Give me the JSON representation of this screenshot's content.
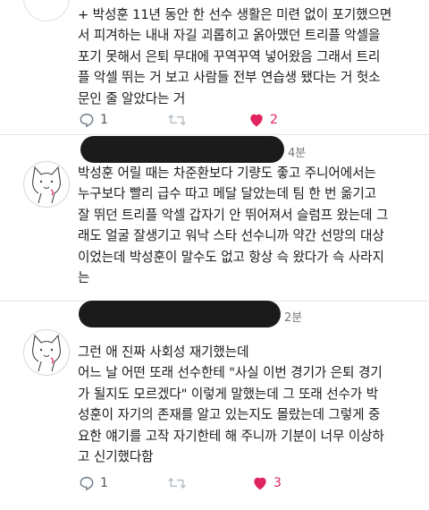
{
  "tweet1": {
    "text": "+ 박성훈 11년 동안 한 선수 생활은 미련 없이 포기했으면\n서 피겨하는 내내 자길 괴롭히고 옭아맸던 트리플 악셀을\n포기 못해서 은퇴 무대에 꾸역꾸역 넣어왔음 그래서 트리\n플 악셀 뛰는 거 보고 사람들 전부 연습생 됐다는 거 헛소\n문인 줄 알았다는 거",
    "replies": "1",
    "retweets": "",
    "likes": "2"
  },
  "tweet2": {
    "time": "4분",
    "text": "박성훈 어릴 때는 차준환보다 기량도 좋고 주니어에서는\n누구보다 빨리 급수 따고 메달 달았는데 팀 한 번 옮기고\n잘 뛰던 트리플 악셀 갑자기 안 뛰어져서 슬럼프 왔는데 그\n래도 얼굴 잘생기고 워낙 스타 선수니까 약간 선망의 대상\n이었는데 박성훈이 말수도 없고 항상 슥 왔다가 슥 사라지\n는",
    "replies": "",
    "retweets": "",
    "likes": ""
  },
  "tweet3": {
    "time": "2분",
    "text": "그런 애 진짜 사회성 재기했는데\n어느 날 어떤 또래 선수한테 \"사실 이번 경기가 은퇴 경기\n가 될지도 모르겠다\" 이렇게 말했는데 그 또래 선수가 박\n성훈이 자기의 존재를 알고 있는지도 몰랐는데 그렇게 중\n요한 얘기를 고작 자기한테 해 주니까 기분이 너무 이상하\n고 신기했다함",
    "replies": "1",
    "retweets": "",
    "likes": "3"
  },
  "colors": {
    "like": "#e0245e",
    "icon": "#6e7b87"
  }
}
